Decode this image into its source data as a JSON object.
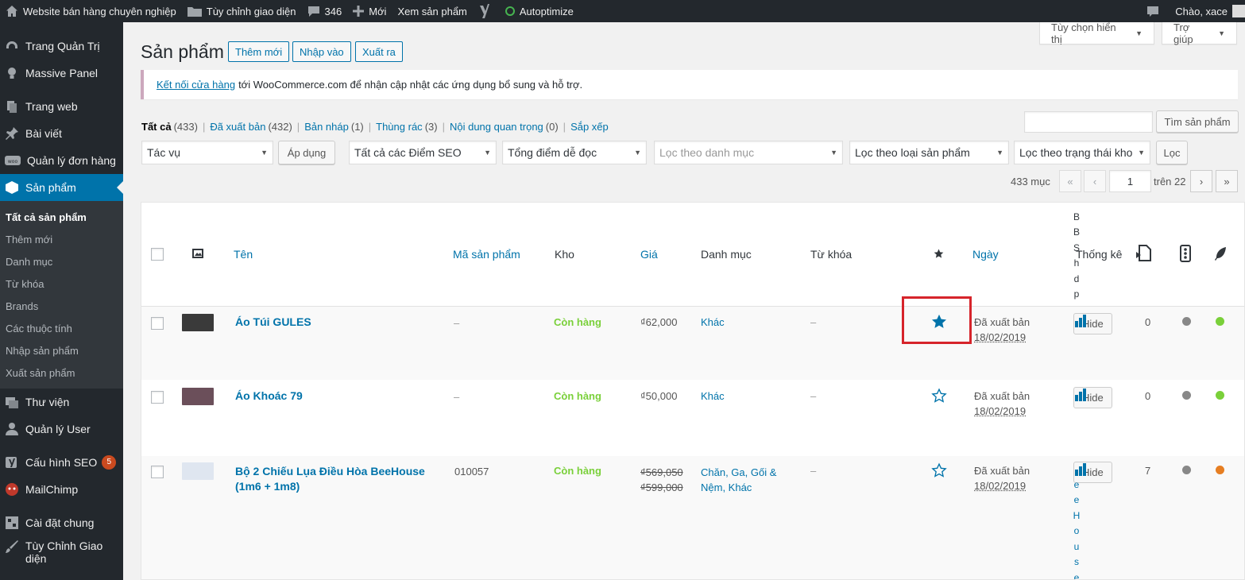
{
  "adminbar": {
    "site": "Website bán hàng chuyên nghiệp",
    "customize": "Tùy chỉnh giao diện",
    "comments": "346",
    "new": "Mới",
    "view": "Xem sản phẩm",
    "autoptimize": "Autoptimize",
    "greeting": "Chào, xace"
  },
  "sidebar": {
    "items": [
      {
        "label": "Trang Quản Trị",
        "icon": "dashboard-icon"
      },
      {
        "label": "Massive Panel",
        "icon": "lightbulb-icon"
      },
      {
        "label": "Trang web",
        "icon": "pages-icon"
      },
      {
        "label": "Bài viết",
        "icon": "pin-icon"
      },
      {
        "label": "Quản lý đơn hàng",
        "icon": "woo-icon"
      },
      {
        "label": "Sản phẩm",
        "icon": "product-box-icon"
      },
      {
        "label": "Thư viện",
        "icon": "media-icon"
      },
      {
        "label": "Quản lý User",
        "icon": "user-icon"
      },
      {
        "label": "Cấu hình SEO",
        "icon": "yoast-icon",
        "badge": "5"
      },
      {
        "label": "MailChimp",
        "icon": "mailchimp-icon"
      },
      {
        "label": "Cài đặt chung",
        "icon": "settings-icon"
      },
      {
        "label": "Tùy Chỉnh Giao diện",
        "icon": "brush-icon"
      }
    ],
    "submenu": [
      "Tất cả sản phẩm",
      "Thêm mới",
      "Danh mục",
      "Từ khóa",
      "Brands",
      "Các thuộc tính",
      "Nhập sản phẩm",
      "Xuất sản phẩm"
    ]
  },
  "screen_options": "Tùy chọn hiển thị",
  "help": "Trợ giúp",
  "page": {
    "title": "Sản phẩm",
    "add_new": "Thêm mới",
    "import": "Nhập vào",
    "export": "Xuất ra"
  },
  "notice": {
    "link": "Kết nối cửa hàng",
    "text": "tới WooCommerce.com để nhận cập nhật các ứng dụng bổ sung và hỗ trợ."
  },
  "views": [
    {
      "label": "Tất cả",
      "count": "(433)"
    },
    {
      "label": "Đã xuất bản",
      "count": "(432)"
    },
    {
      "label": "Bản nháp",
      "count": "(1)"
    },
    {
      "label": "Thùng rác",
      "count": "(3)"
    },
    {
      "label": "Nội dung quan trọng",
      "count": "(0)"
    },
    {
      "label": "Sắp xếp",
      "count": ""
    }
  ],
  "search": {
    "button": "Tìm sản phẩm",
    "value": ""
  },
  "filters": {
    "bulk": "Tác vụ",
    "apply": "Áp dụng",
    "seo": "Tất cả các Điểm SEO",
    "readability": "Tổng điểm dễ đọc",
    "category": "Lọc theo danh mục",
    "type": "Lọc theo loại sản phẩm",
    "stock": "Lọc theo trạng thái kho",
    "filter": "Lọc"
  },
  "pagination": {
    "items": "433 mục",
    "first": "«",
    "prev": "‹",
    "current": "1",
    "of": "trên 22",
    "next": "›",
    "last": "»"
  },
  "columns": {
    "name": "Tên",
    "sku": "Mã sản phẩm",
    "stock": "Kho",
    "price": "Giá",
    "category": "Danh mục",
    "tags": "Từ khóa",
    "date": "Ngày",
    "stats": "Thống kê",
    "brands_vertical": [
      "B",
      "B",
      "S",
      "h",
      "d",
      "p"
    ]
  },
  "rows": [
    {
      "name": "Áo Túi GULES",
      "sku": "–",
      "stock": "Còn hàng",
      "price": "₫62,000",
      "price_old": "",
      "category": "Khác",
      "category2": "",
      "tags": "–",
      "featured": true,
      "status": "Đã xuất bản",
      "date": "18/02/2019",
      "hide": "Hide",
      "count": "0",
      "dot1": "#888888",
      "dot2": "#7ad03a"
    },
    {
      "name": "Áo Khoác 79",
      "sku": "–",
      "stock": "Còn hàng",
      "price": "₫50,000",
      "price_old": "",
      "category": "Khác",
      "category2": "",
      "tags": "–",
      "featured": false,
      "status": "Đã xuất bản",
      "date": "18/02/2019",
      "hide": "Hide",
      "count": "0",
      "dot1": "#888888",
      "dot2": "#7ad03a"
    },
    {
      "name": "Bộ 2 Chiếu Lụa Điều Hòa BeeHouse",
      "name2": "(1m6 + 1m8)",
      "sku": "010057",
      "stock": "Còn hàng",
      "price": "₫569,050",
      "price_old": "₫599,000",
      "category": "Chăn, Ga, Gối &",
      "category2": "Nệm, Khác",
      "tags": "–",
      "featured": false,
      "status": "Đã xuất bản",
      "date": "18/02/2019",
      "hide": "Hide",
      "count": "7",
      "dot1": "#888888",
      "dot2": "#e67e22",
      "brand_vertical": [
        "e",
        "e",
        "H",
        "o",
        "u",
        "s",
        "e"
      ]
    }
  ]
}
